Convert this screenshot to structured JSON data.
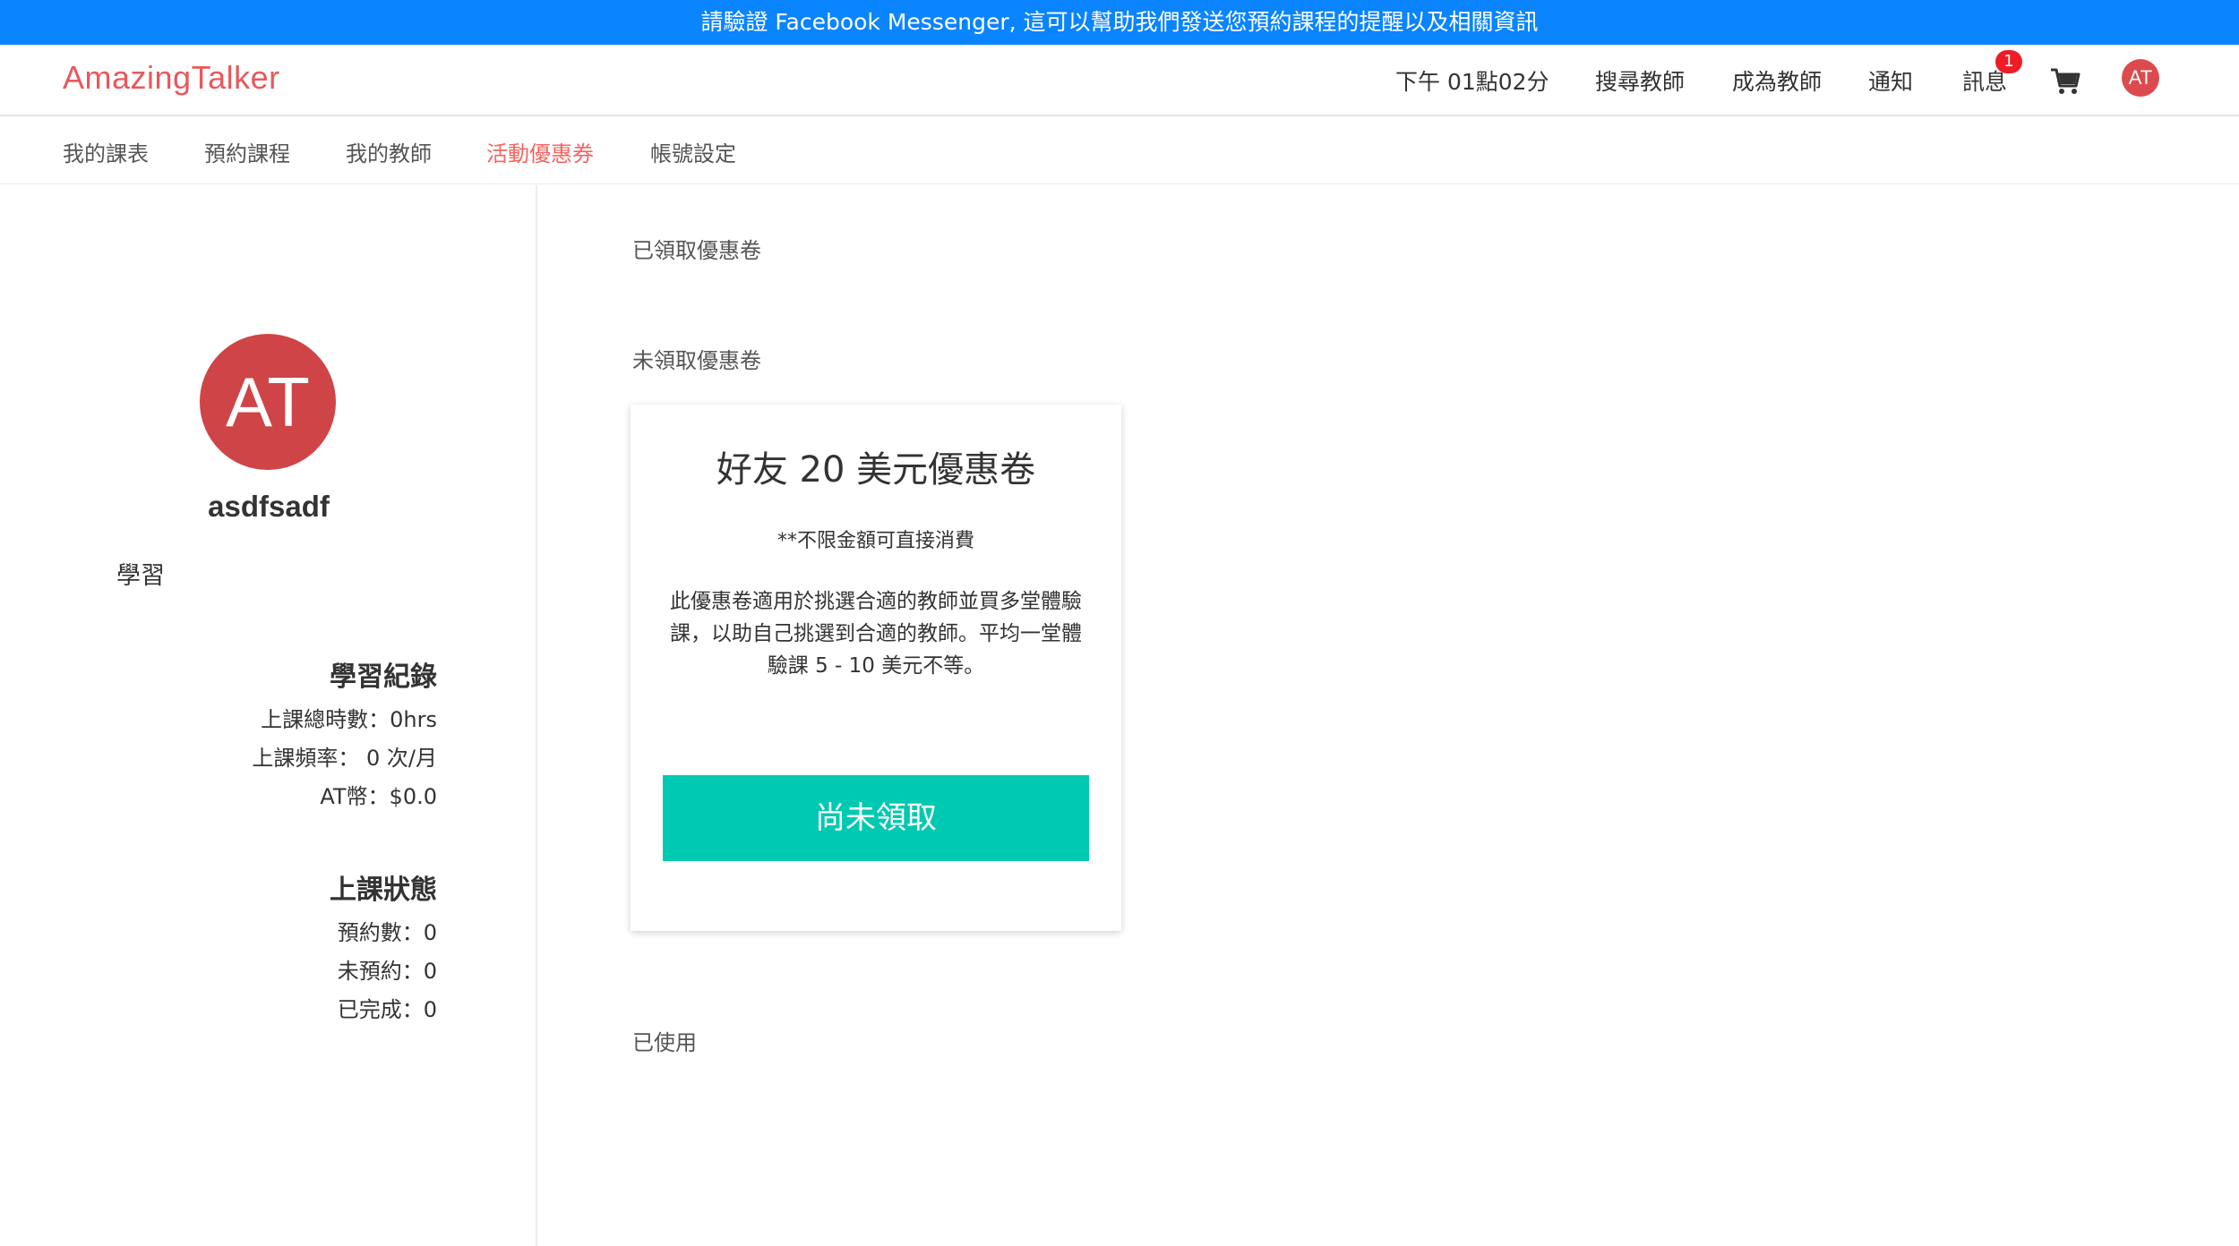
{
  "banner": {
    "text": "請驗證 Facebook Messenger, 這可以幫助我們發送您預約課程的提醒以及相關資訊"
  },
  "header": {
    "logo": "AmazingTalker",
    "time": "下午 01點02分",
    "search_teachers": "搜尋教師",
    "become_teacher": "成為教師",
    "notifications": "通知",
    "messages": "訊息",
    "messages_badge": "1",
    "avatar_initials": "AT",
    "colors": {
      "logo": "#e9585b",
      "badge": "#ee1c25",
      "avatar": "#dd4a4d"
    }
  },
  "subnav": {
    "tabs": [
      {
        "label": "我的課表"
      },
      {
        "label": "預約課程"
      },
      {
        "label": "我的教師"
      },
      {
        "label": "活動優惠券",
        "active": true
      },
      {
        "label": "帳號設定"
      }
    ],
    "active_color": "#f4645f"
  },
  "profile": {
    "avatar_initials": "AT",
    "username": "asdfsadf",
    "role": "學習",
    "learning_record": {
      "title": "學習紀錄",
      "total_hours": "上課總時數：0hrs",
      "frequency": "上課頻率： 0 次/月",
      "at_coins": "AT幣：$0.0"
    },
    "class_status": {
      "title": "上課狀態",
      "booked": "預約數：0",
      "unbooked": "未預約：0",
      "completed": "已完成：0"
    }
  },
  "coupons": {
    "claimed_label": "已領取優惠卷",
    "unclaimed_label": "未領取優惠卷",
    "used_label": "已使用",
    "card": {
      "title": "好友 20 美元優惠卷",
      "note": "**不限金額可直接消費",
      "description": "此優惠卷適用於挑選合適的教師並買多堂體驗課，以助自己挑選到合適的教師。平均一堂體驗課 5 - 10 美元不等。",
      "button": "尚未領取",
      "button_color": "#00c9b2"
    }
  },
  "icons": {
    "cart": "shopping-cart-icon"
  }
}
